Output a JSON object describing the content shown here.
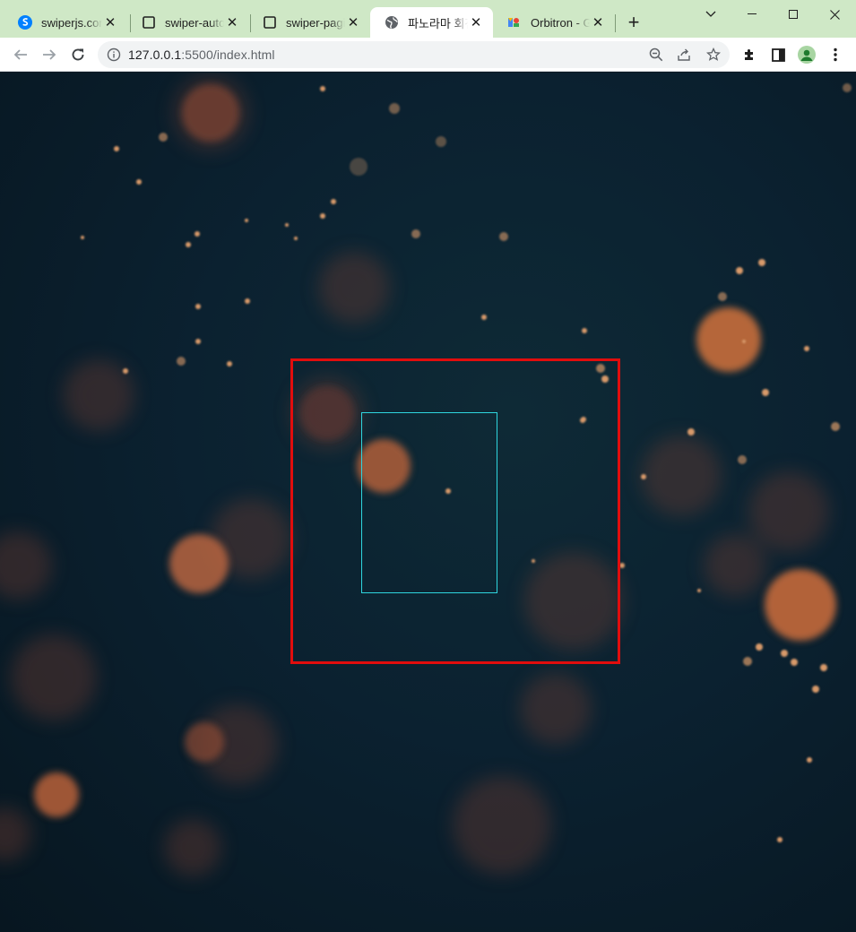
{
  "browser": {
    "tabs": [
      {
        "title": "swiperjs.com",
        "favicon": "swiper-logo-icon",
        "active": false
      },
      {
        "title": "swiper-autoplay",
        "favicon": "page-icon",
        "active": false
      },
      {
        "title": "swiper-pagination",
        "favicon": "page-icon",
        "active": false
      },
      {
        "title": "파노라마 회전",
        "favicon": "globe-icon",
        "active": true
      },
      {
        "title": "Orbitron - Google Fonts",
        "favicon": "google-fonts-icon",
        "active": false
      }
    ],
    "close_glyph": "✕",
    "new_tab_glyph": "+",
    "address": {
      "host": "127.0.0.1",
      "rest": ":5500/index.html"
    }
  },
  "page": {
    "background": "bokeh-particles",
    "outer_box_color": "#e10d0d",
    "inner_box_color": "#2fd6df"
  }
}
